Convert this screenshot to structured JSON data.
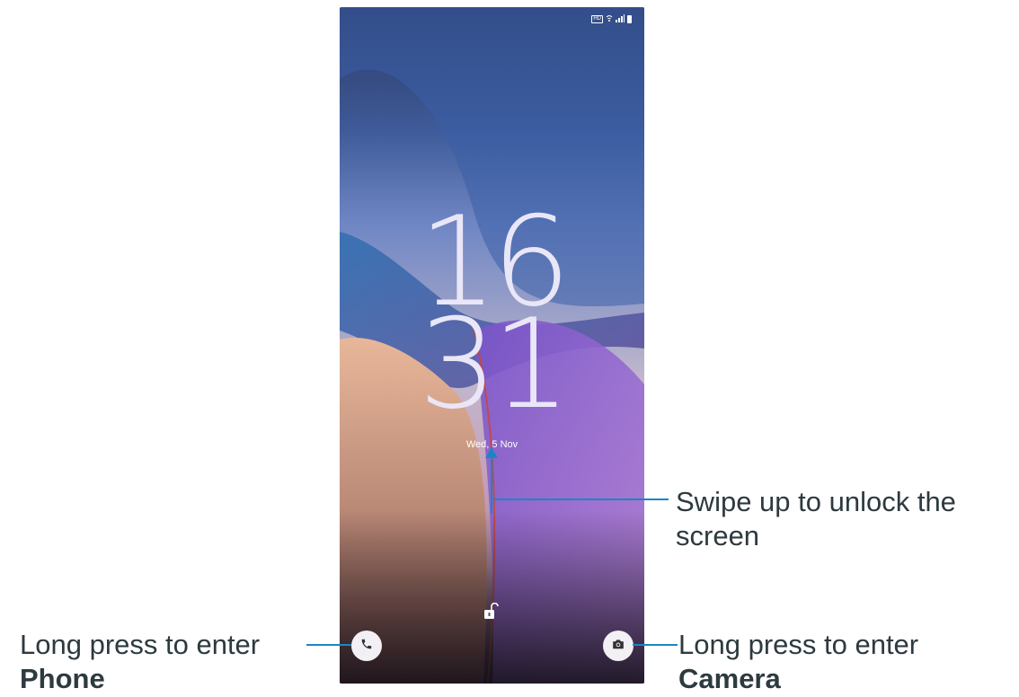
{
  "status_bar": {
    "icons": [
      "hd-icon",
      "wifi-icon",
      "signal-icon",
      "battery-icon"
    ],
    "hd_label": "HD"
  },
  "clock": {
    "hours": "16",
    "minutes": "31"
  },
  "date": "Wed, 5 Nov",
  "callouts": {
    "unlock": {
      "line1": "Swipe up to unlock the",
      "line2": "screen"
    },
    "phone": {
      "line1": "Long press to enter",
      "line2": "Phone"
    },
    "camera": {
      "line1": "Long press to enter",
      "line2": "Camera"
    }
  },
  "colors": {
    "callout_line": "#1a86c8",
    "callout_text": "#2d3a3f",
    "clock_text": "#e9e6f7"
  }
}
